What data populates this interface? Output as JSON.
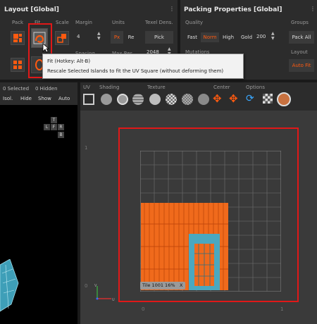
{
  "layout_panel": {
    "title": "Layout [Global]",
    "col_pack": "Pack",
    "col_fit": "Fit",
    "col_scale": "Scale",
    "col_margin": "Margin",
    "col_units": "Units",
    "col_texel": "Texel Dens.",
    "margin_value": "4",
    "units_px": "Px",
    "units_re": "Re",
    "texel_pick": "Pick",
    "spacing_label": "Spacing",
    "maxres_label": "Max Res",
    "maxres_value": "2048"
  },
  "packing_panel": {
    "title": "Packing Properties [Global]",
    "quality_label": "Quality",
    "groups_label": "Groups",
    "fast": "Fast",
    "norm": "Norm",
    "high": "High",
    "gold": "Gold",
    "gold_value": "200",
    "pack_all": "Pack All",
    "mutations_label": "Mutations",
    "layout_label": "Layout",
    "auto_fit": "Auto Fit"
  },
  "tooltip": {
    "title": "Fit (Hotkey: Alt-B)",
    "body": "Rescale Selected Islands to fit the UV Square (without deforming them)"
  },
  "left_toolbar": {
    "selected": "0 Selected",
    "hidden": "0 Hidden",
    "isol": "Isol.",
    "hide": "Hide",
    "show": "Show",
    "auto": "Auto"
  },
  "viewcube": {
    "top": "T",
    "left": "L",
    "front": "F",
    "right": "R",
    "bottom": "B"
  },
  "uv_toolbar": {
    "uv_label": "UV",
    "shading_label": "Shading",
    "texture_label": "Texture",
    "center_label": "Center",
    "options_label": "Options"
  },
  "viewport": {
    "tile_label": "Tile 1001 16%",
    "tile_close": "X",
    "axis_y_label": "1",
    "axis_origin_label": "0",
    "ruler_0": "0",
    "ruler_1": "1"
  },
  "colors": {
    "accent": "#ff5a10",
    "highlight_box": "#e01818",
    "uv_fill": "#f06a1c",
    "uv_teal": "#4aa8c0"
  }
}
